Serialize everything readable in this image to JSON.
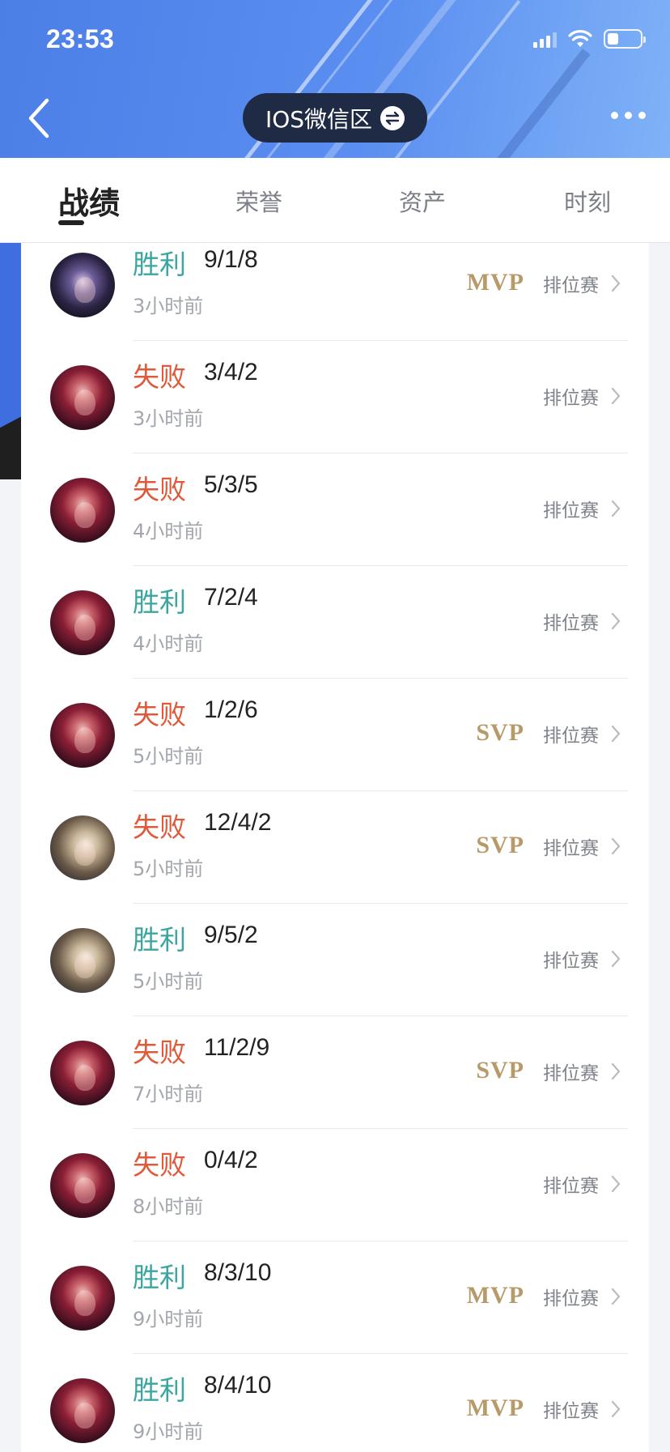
{
  "status_bar": {
    "time": "23:53",
    "battery_level": 0.35
  },
  "nav": {
    "region_label": "IOS微信区"
  },
  "tabs": [
    {
      "label": "战绩",
      "active": true
    },
    {
      "label": "荣誉",
      "active": false
    },
    {
      "label": "资产",
      "active": false
    },
    {
      "label": "时刻",
      "active": false
    }
  ],
  "matches": [
    {
      "result": "胜利",
      "outcome": "win",
      "kda": "9/1/8",
      "time": "3小时前",
      "badge": "MVP",
      "mode": "排位赛"
    },
    {
      "result": "失败",
      "outcome": "loss",
      "kda": "3/4/2",
      "time": "3小时前",
      "badge": "",
      "mode": "排位赛"
    },
    {
      "result": "失败",
      "outcome": "loss",
      "kda": "5/3/5",
      "time": "4小时前",
      "badge": "",
      "mode": "排位赛"
    },
    {
      "result": "胜利",
      "outcome": "win",
      "kda": "7/2/4",
      "time": "4小时前",
      "badge": "",
      "mode": "排位赛"
    },
    {
      "result": "失败",
      "outcome": "loss",
      "kda": "1/2/6",
      "time": "5小时前",
      "badge": "SVP",
      "mode": "排位赛"
    },
    {
      "result": "失败",
      "outcome": "loss",
      "kda": "12/4/2",
      "time": "5小时前",
      "badge": "SVP",
      "mode": "排位赛"
    },
    {
      "result": "胜利",
      "outcome": "win",
      "kda": "9/5/2",
      "time": "5小时前",
      "badge": "",
      "mode": "排位赛"
    },
    {
      "result": "失败",
      "outcome": "loss",
      "kda": "11/2/9",
      "time": "7小时前",
      "badge": "SVP",
      "mode": "排位赛"
    },
    {
      "result": "失败",
      "outcome": "loss",
      "kda": "0/4/2",
      "time": "8小时前",
      "badge": "",
      "mode": "排位赛"
    },
    {
      "result": "胜利",
      "outcome": "win",
      "kda": "8/3/10",
      "time": "9小时前",
      "badge": "MVP",
      "mode": "排位赛"
    },
    {
      "result": "胜利",
      "outcome": "win",
      "kda": "8/4/10",
      "time": "9小时前",
      "badge": "MVP",
      "mode": "排位赛"
    }
  ],
  "colors": {
    "win": "#3aa6a0",
    "loss": "#e0593a",
    "badge_gold": "#b79a69",
    "header_blue": "#4c7fe6"
  }
}
